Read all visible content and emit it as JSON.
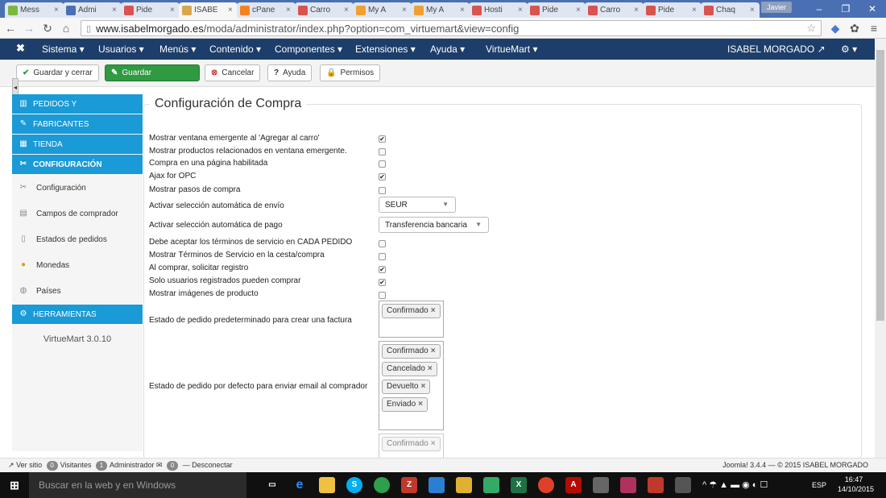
{
  "browser": {
    "tabs": [
      "Mess",
      "Admi",
      "Pide",
      "ISABE",
      "cPane",
      "Carro",
      "My A",
      "My A",
      "Hosti",
      "Pide",
      "Carro",
      "Pide",
      "Chaq"
    ],
    "user_badge": "Javier",
    "url_host": "www.isabelmorgado.es",
    "url_path": "/moda/administrator/index.php?option=com_virtuemart&view=config"
  },
  "admin_menu": {
    "items": [
      "Sistema ▾",
      "Usuarios ▾",
      "Menús ▾",
      "Contenido ▾",
      "Componentes ▾",
      "Extensiones ▾",
      "Ayuda ▾",
      "VirtueMart ▾"
    ],
    "user": "ISABEL MORGADO"
  },
  "toolbar": {
    "save_close": "Guardar y cerrar",
    "save": "Guardar",
    "cancel": "Cancelar",
    "help": "Ayuda",
    "permissions": "Permisos"
  },
  "sidebar": {
    "headers": [
      "PEDIDOS Y",
      "FABRICANTES",
      "TIENDA",
      "CONFIGURACIÓN"
    ],
    "items": [
      "Configuración",
      "Campos de comprador",
      "Estados de pedidos",
      "Monedas",
      "Países"
    ],
    "tools": "HERRAMIENTAS",
    "version": "VirtueMart 3.0.10"
  },
  "section_title": "Configuración de Compra",
  "settings": [
    {
      "label": "Mostrar ventana emergente al 'Agregar al carro'",
      "checked": true
    },
    {
      "label": "Mostrar productos relacionados en ventana emergente.",
      "checked": false
    },
    {
      "label": "Compra en una página habilitada",
      "checked": false
    },
    {
      "label": "Ajax for OPC",
      "checked": true
    },
    {
      "label": "Mostrar pasos de compra",
      "checked": false
    }
  ],
  "shipping_select": {
    "label": "Activar selección automática de envío",
    "value": "SEUR"
  },
  "payment_select": {
    "label": "Activar selección automática de pago",
    "value": "Transferencia bancaria"
  },
  "settings2": [
    {
      "label": "Debe aceptar los términos de servicio en CADA PEDIDO",
      "checked": false
    },
    {
      "label": "Mostrar Términos de Servicio en la cesta/compra",
      "checked": false
    },
    {
      "label": "Al comprar, solicitar registro",
      "checked": true
    },
    {
      "label": "Solo usuarios registrados pueden comprar",
      "checked": true
    },
    {
      "label": "Mostrar imágenes de producto",
      "checked": false
    }
  ],
  "invoice_status": {
    "label": "Estado de pedido predeterminado para crear una factura",
    "chips": [
      "Confirmado"
    ]
  },
  "email_status": {
    "label": "Estado de pedido por defecto para enviar email al comprador",
    "chips": [
      "Confirmado",
      "Cancelado",
      "Devuelto",
      "Enviado"
    ]
  },
  "partial_chip": "Confirmado",
  "status_bar": {
    "view_site": "Ver sitio",
    "visitors_count": "0",
    "visitors": "Visitantes",
    "admins_count": "1",
    "admins": "Administrador",
    "messages_count": "0",
    "logout": "Desconectar",
    "footer": "Joomla! 3.4.4 — © 2015 ISABEL MORGADO"
  },
  "taskbar": {
    "search_placeholder": "Buscar en la web y en Windows",
    "lang": "ESP",
    "time": "16:47",
    "date": "14/10/2015"
  }
}
